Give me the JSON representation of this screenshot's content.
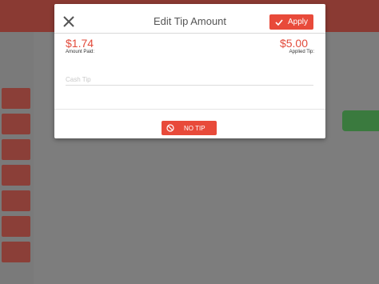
{
  "colors": {
    "accent": "#e84a3a",
    "overlay": "#7d7d7d",
    "modal_bg": "#ffffff"
  },
  "modal": {
    "title": "Edit Tip Amount",
    "close_icon": "close-icon",
    "apply": {
      "label": "Apply",
      "icon": "check-icon"
    },
    "amount_paid": {
      "value": "$1.74",
      "label": "Amount Paid:"
    },
    "applied_tip": {
      "value": "$5.00",
      "label": "Applied Tip:"
    },
    "cash_tip": {
      "placeholder": "Cash Tip",
      "value": ""
    },
    "no_tip": {
      "label": "NO TIP",
      "icon": "no-entry-icon"
    }
  }
}
